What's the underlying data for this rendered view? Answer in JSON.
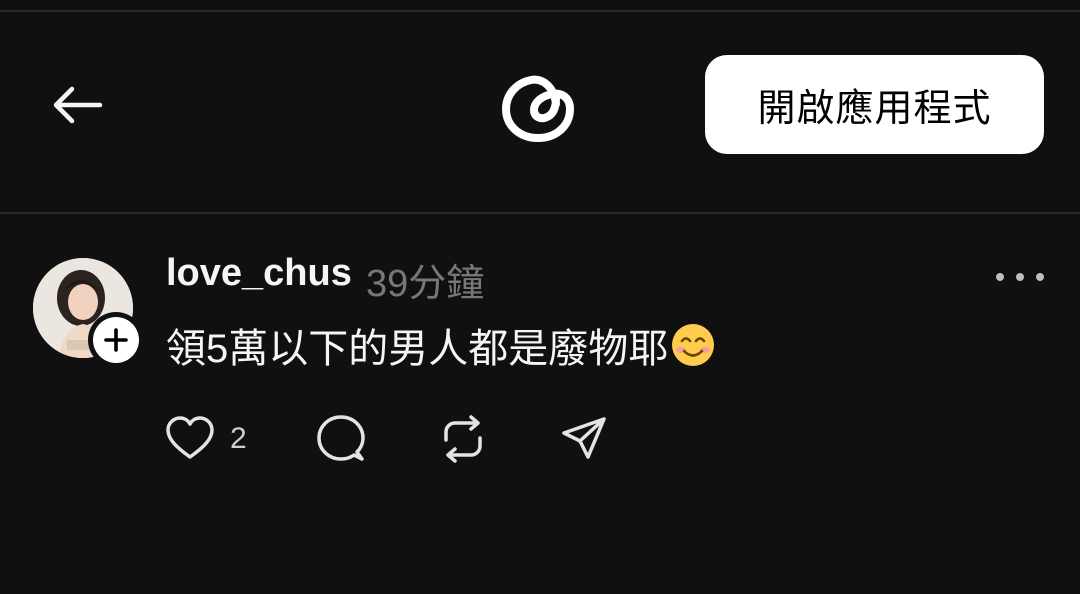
{
  "header": {
    "back_icon": "arrow-left-icon",
    "logo_icon": "threads-logo-icon",
    "open_app_label": "開啟應用程式"
  },
  "post": {
    "author": {
      "username": "love_chus",
      "avatar": "avatar-photo",
      "follow_icon": "plus-icon"
    },
    "timestamp": "39分鐘",
    "text": "領5萬以下的男人都是廢物耶",
    "emoji": "smiling-face-emoji",
    "more_icon": "more-horizontal-icon",
    "actions": {
      "like_icon": "heart-icon",
      "like_count": "2",
      "reply_icon": "comment-icon",
      "repost_icon": "repost-icon",
      "share_icon": "send-icon"
    }
  },
  "colors": {
    "background": "#101010",
    "primary_text": "#f3f5f7",
    "secondary_text": "#777777",
    "button_bg": "#ffffff"
  }
}
